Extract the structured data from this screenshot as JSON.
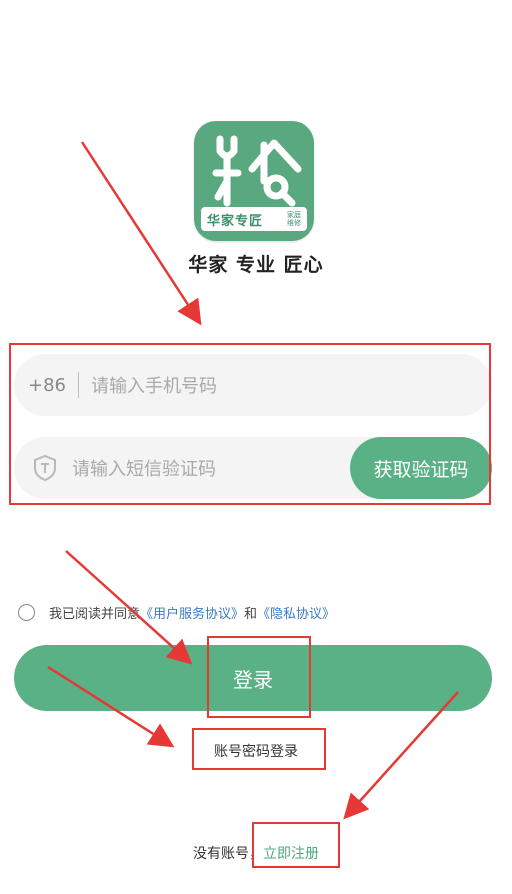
{
  "logo": {
    "brand_text": "华家专匠",
    "sub_text": "家庭维修"
  },
  "slogan": "华家 专业 匠心",
  "phone_field": {
    "prefix": "+86",
    "placeholder": "请输入手机号码"
  },
  "code_field": {
    "placeholder": "请输入短信验证码",
    "button_label": "获取验证码"
  },
  "agreement": {
    "text": "我已阅读并同意",
    "user_agreement": "《用户服务协议》",
    "and": "和",
    "privacy_policy": "《隐私协议》"
  },
  "login_button": "登录",
  "password_login": "账号密码登录",
  "signup": {
    "prompt": "没有账号，",
    "link": "立即注册"
  },
  "colors": {
    "primary_green": "#5ab185",
    "link_blue": "#3a78c4",
    "annotation_red": "#e53935"
  }
}
